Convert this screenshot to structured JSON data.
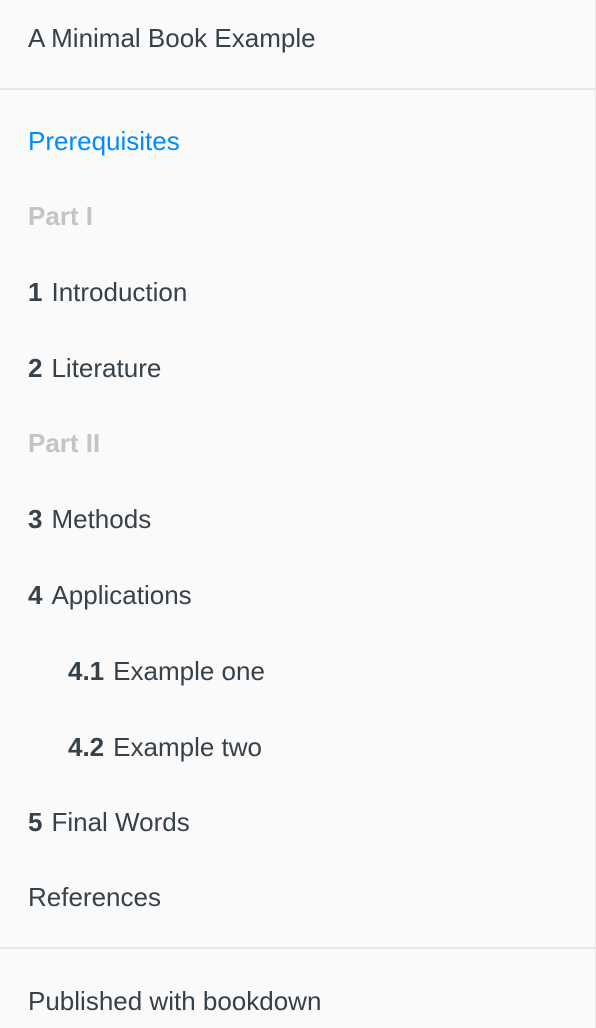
{
  "toc": {
    "book_title": "A Minimal Book Example",
    "entries": [
      {
        "kind": "link",
        "number": "",
        "label": "Prerequisites",
        "active": true
      },
      {
        "kind": "part",
        "label": "Part I"
      },
      {
        "kind": "link",
        "number": "1",
        "label": "Introduction"
      },
      {
        "kind": "link",
        "number": "2",
        "label": "Literature"
      },
      {
        "kind": "part",
        "label": "Part II"
      },
      {
        "kind": "link",
        "number": "3",
        "label": "Methods"
      },
      {
        "kind": "link",
        "number": "4",
        "label": "Applications"
      },
      {
        "kind": "sublink",
        "number": "4.1",
        "label": "Example one"
      },
      {
        "kind": "sublink",
        "number": "4.2",
        "label": "Example two"
      },
      {
        "kind": "link",
        "number": "5",
        "label": "Final Words"
      },
      {
        "kind": "link",
        "number": "",
        "label": "References"
      }
    ],
    "footer_text": "Published with bookdown"
  },
  "colors": {
    "active_link": "#008cff",
    "text": "#364149",
    "part_header": "#c3c4c6",
    "background": "#fafafa"
  }
}
